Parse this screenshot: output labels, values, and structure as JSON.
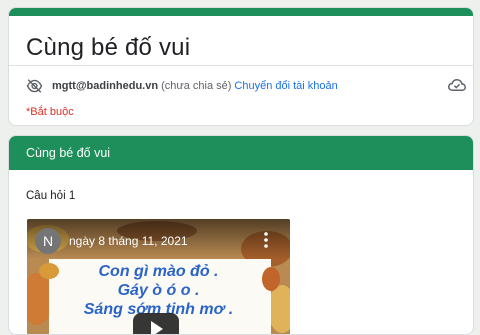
{
  "form": {
    "title": "Cùng bé đố vui",
    "account_email": "mgtt@badinhedu.vn",
    "shared_status": "(chưa chia sẻ)",
    "switch_account": "Chuyển đổi tài khoản",
    "required_note": "*Bắt buộc"
  },
  "section": {
    "title": "Cùng bé đố vui"
  },
  "question": {
    "label": "Câu hỏi 1"
  },
  "video": {
    "avatar_letter": "N",
    "title": "ngày 8 tháng 11, 2021",
    "lines": [
      "Con gì mào đỏ .",
      "Gáy ò ó o .",
      "Sáng sớm tinh mơ ."
    ]
  },
  "colors": {
    "accent": "#1e8e5a",
    "link": "#1a73e8",
    "required": "#d93025",
    "poem_text": "#2a63c9"
  },
  "icons": {
    "visibility": "eye-off-icon",
    "cloud": "cloud-icon",
    "more": "more-vert-icon",
    "play": "play-icon"
  }
}
